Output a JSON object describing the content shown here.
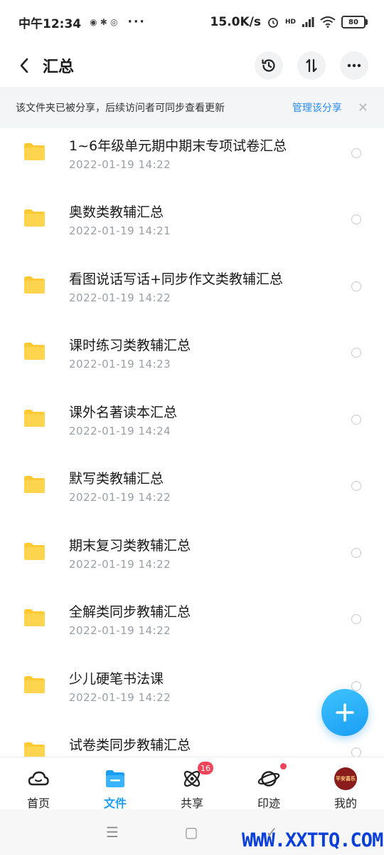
{
  "status_bar": {
    "time": "中午12:34",
    "dots": "···",
    "net_speed": "15.0K/s",
    "hd_label": "HD",
    "battery": "80"
  },
  "header": {
    "title": "汇总",
    "back_icon": "chevron-left-icon",
    "actions": [
      "history-icon",
      "sort-icon",
      "more-icon"
    ]
  },
  "share_banner": {
    "message": "该文件夹已被分享，后续访问者可同步查看更新",
    "manage_label": "管理该分享",
    "close_label": "✕"
  },
  "files": [
    {
      "name": "1~6年级单元期中期末专项试卷汇总",
      "date": "2022-01-19  14:22"
    },
    {
      "name": "奥数类教辅汇总",
      "date": "2022-01-19  14:21"
    },
    {
      "name": "看图说话写话+同步作文类教辅汇总",
      "date": "2022-01-19  14:22"
    },
    {
      "name": "课时练习类教辅汇总",
      "date": "2022-01-19  14:23"
    },
    {
      "name": "课外名著读本汇总",
      "date": "2022-01-19  14:24"
    },
    {
      "name": "默写类教辅汇总",
      "date": "2022-01-19  14:22"
    },
    {
      "name": "期末复习类教辅汇总",
      "date": "2022-01-19  14:22"
    },
    {
      "name": "全解类同步教辅汇总",
      "date": "2022-01-19  14:22"
    },
    {
      "name": "少儿硬笔书法课",
      "date": "2022-01-19  14:22"
    },
    {
      "name": "试卷类同步教辅汇总",
      "date": ""
    }
  ],
  "colors": {
    "accent": "#1a9ef3",
    "folder": "#ffc933",
    "badge": "#f04458"
  },
  "bottom_nav": {
    "items": [
      {
        "label": "首页",
        "icon": "cloud-home-icon"
      },
      {
        "label": "文件",
        "icon": "folder-icon",
        "active": true
      },
      {
        "label": "共享",
        "icon": "atom-share-icon",
        "badge": "16"
      },
      {
        "label": "印迹",
        "icon": "planet-icon",
        "dot": true
      },
      {
        "label": "我的",
        "icon": "avatar"
      }
    ],
    "avatar_text": "平安喜乐"
  },
  "system_nav": {
    "menu_glyph": "☰",
    "home_glyph": "▢",
    "back_glyph": "✓"
  },
  "watermark": "WWW.XXTTQ.COM"
}
